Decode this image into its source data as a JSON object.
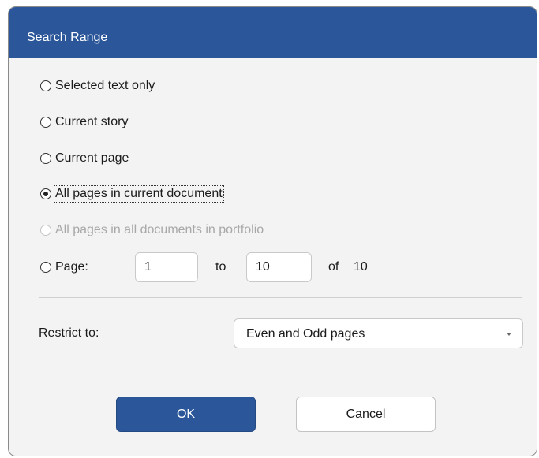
{
  "dialog": {
    "title": "Search Range"
  },
  "options": {
    "selected_text": "Selected text only",
    "current_story": "Current story",
    "current_page": "Current page",
    "all_pages_current": "All pages in current document",
    "all_pages_portfolio": "All pages in all documents in portfolio",
    "page": "Page:"
  },
  "selected_option": "all_pages_current",
  "page_range": {
    "from_value": "1",
    "to_label": "to",
    "to_value": "10",
    "of_label": "of",
    "total": "10"
  },
  "restrict": {
    "label": "Restrict to:",
    "selected": "Even and Odd pages"
  },
  "buttons": {
    "ok": "OK",
    "cancel": "Cancel"
  },
  "colors": {
    "accent": "#2b579a",
    "dialog_background": "#f3f3f3",
    "disabled_text": "#a8a8a8"
  }
}
